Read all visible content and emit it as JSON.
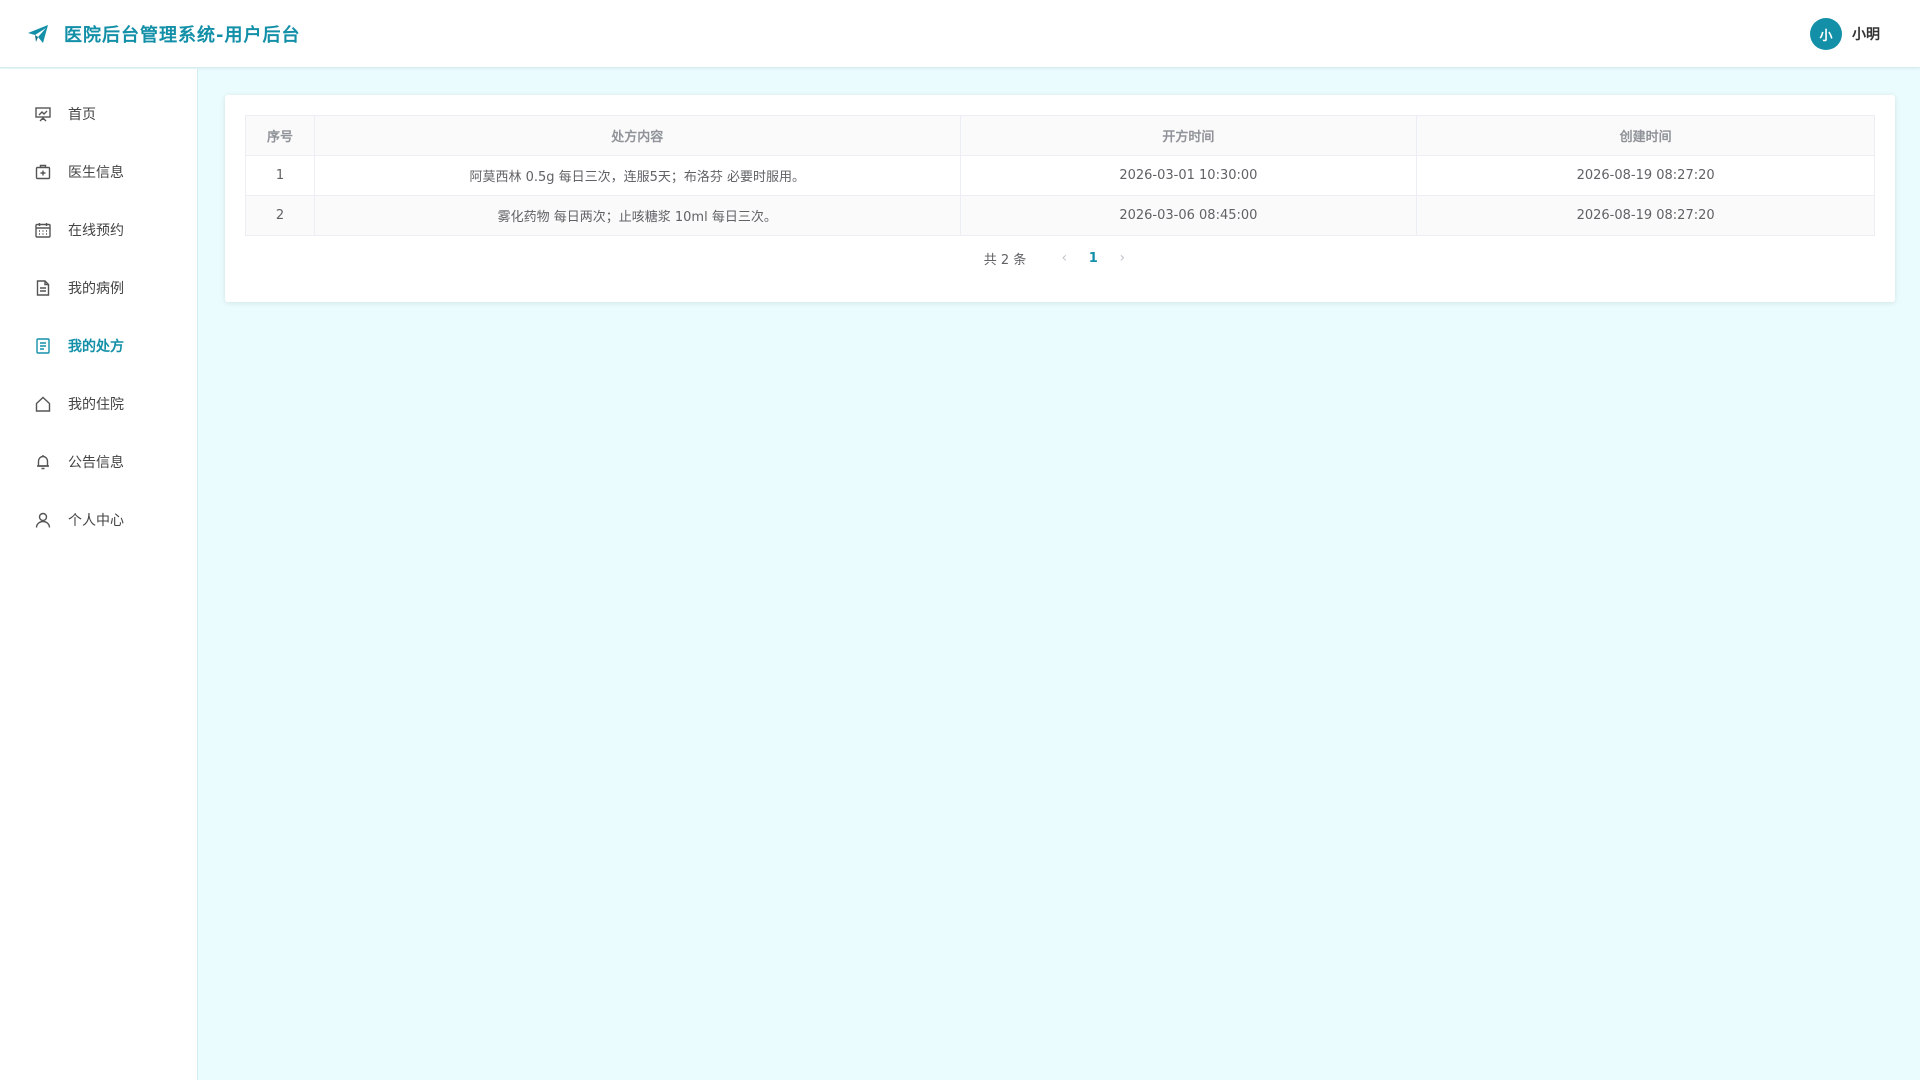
{
  "header": {
    "title": "医院后台管理系统-用户后台",
    "user": {
      "avatar_text": "小",
      "name": "小明"
    }
  },
  "sidebar": {
    "items": [
      {
        "label": "首页",
        "icon": "presentation-icon"
      },
      {
        "label": "医生信息",
        "icon": "medical-kit-icon"
      },
      {
        "label": "在线预约",
        "icon": "calendar-icon"
      },
      {
        "label": "我的病例",
        "icon": "document-icon"
      },
      {
        "label": "我的处方",
        "icon": "list-document-icon",
        "active": true
      },
      {
        "label": "我的住院",
        "icon": "house-icon"
      },
      {
        "label": "公告信息",
        "icon": "bell-icon"
      },
      {
        "label": "个人中心",
        "icon": "user-icon"
      }
    ]
  },
  "table": {
    "headers": [
      "序号",
      "处方内容",
      "开方时间",
      "创建时间"
    ],
    "rows": [
      {
        "index": "1",
        "content": "阿莫西林 0.5g 每日三次，连服5天；布洛芬 必要时服用。",
        "open_time": "2026-03-01 10:30:00",
        "create_time": "2026-08-19 08:27:20"
      },
      {
        "index": "2",
        "content": "雾化药物 每日两次；止咳糖浆 10ml 每日三次。",
        "open_time": "2026-03-06 08:45:00",
        "create_time": "2026-08-19 08:27:20"
      }
    ]
  },
  "pagination": {
    "total_label": "共 2 条",
    "current_page": "1",
    "prev_icon": "‹",
    "next_icon": "›"
  },
  "colors": {
    "accent": "#1390a8",
    "background": "#eafcfe"
  }
}
